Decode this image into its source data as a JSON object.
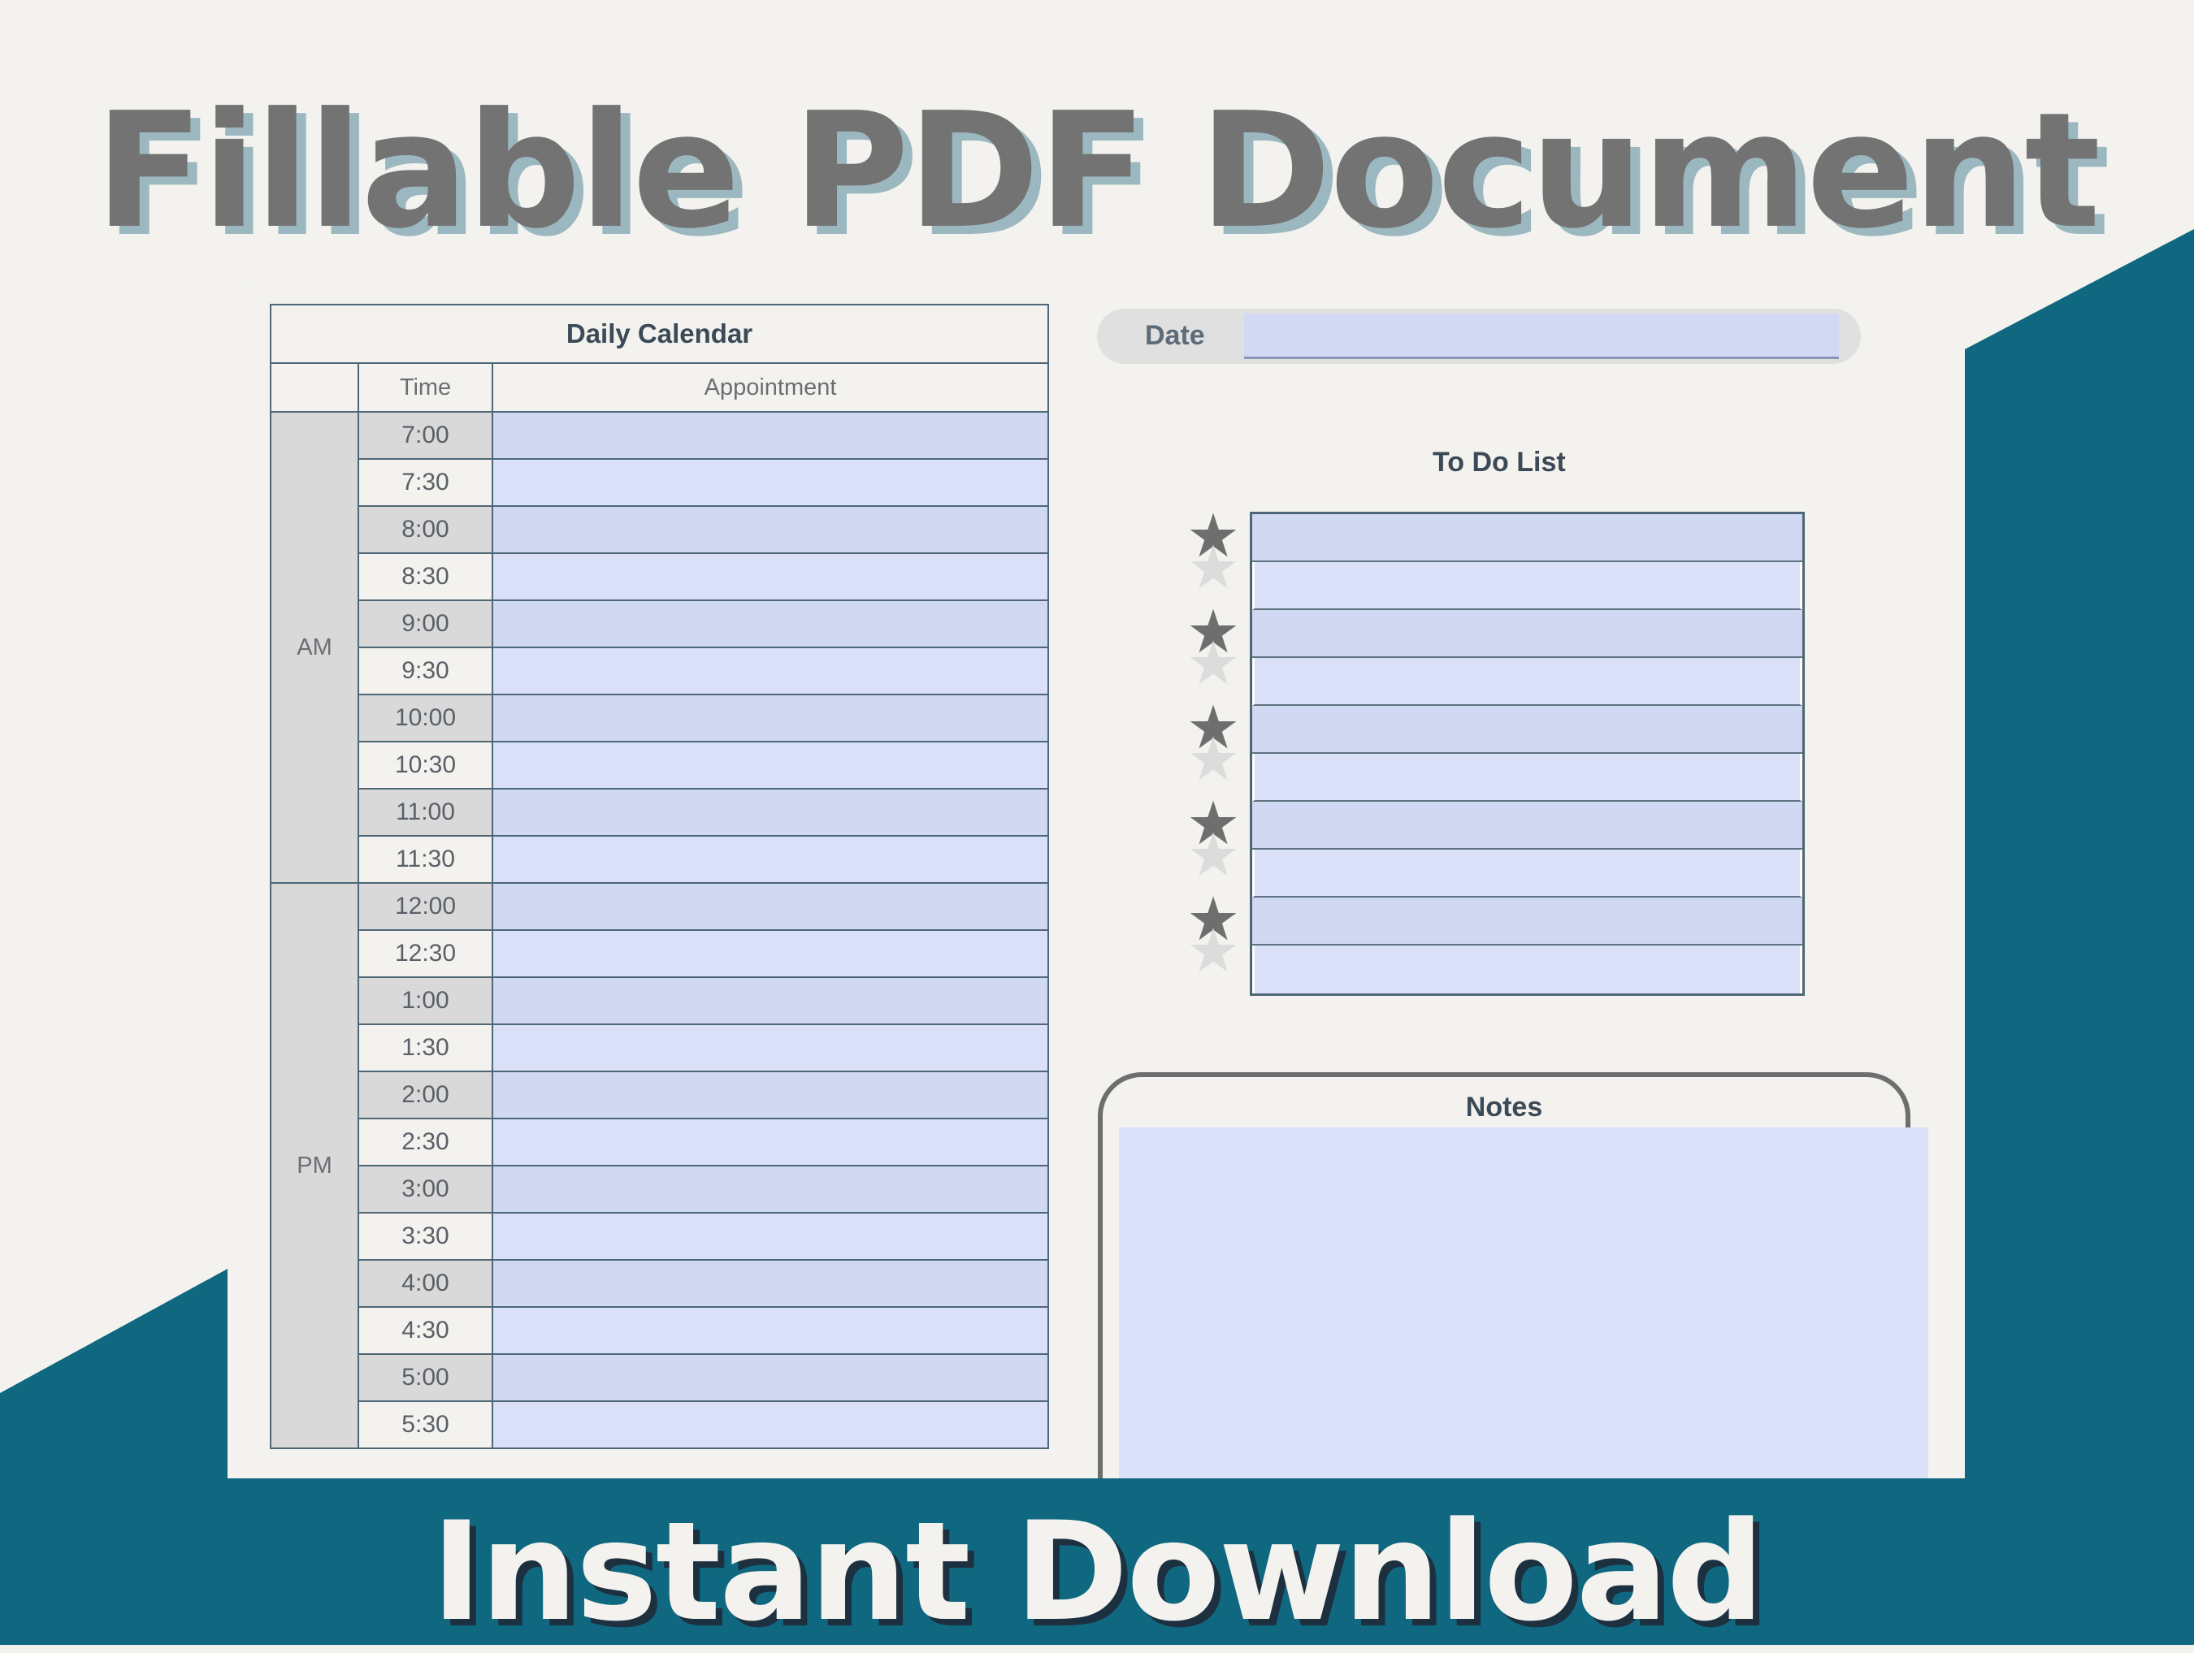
{
  "banner": {
    "title": "Fillable PDF Document",
    "footer": "Instant Download"
  },
  "colors": {
    "teal": "#0f6880",
    "background": "#f3f2ee",
    "field_fill": "#d9e0f8",
    "field_fill_alt": "#d0d8f2"
  },
  "calendar": {
    "title": "Daily Calendar",
    "col_time": "Time",
    "col_appointment": "Appointment",
    "am_label": "AM",
    "pm_label": "PM",
    "am_times": [
      "7:00",
      "7:30",
      "8:00",
      "8:30",
      "9:00",
      "9:30",
      "10:00",
      "10:30",
      "11:00",
      "11:30"
    ],
    "pm_times": [
      "12:00",
      "12:30",
      "1:00",
      "1:30",
      "2:00",
      "2:30",
      "3:00",
      "3:30",
      "4:00",
      "4:30",
      "5:00",
      "5:30"
    ]
  },
  "date": {
    "label": "Date"
  },
  "todo": {
    "title": "To Do List",
    "row_count": 10,
    "star_icon": "star-icon"
  },
  "notes": {
    "title": "Notes"
  }
}
